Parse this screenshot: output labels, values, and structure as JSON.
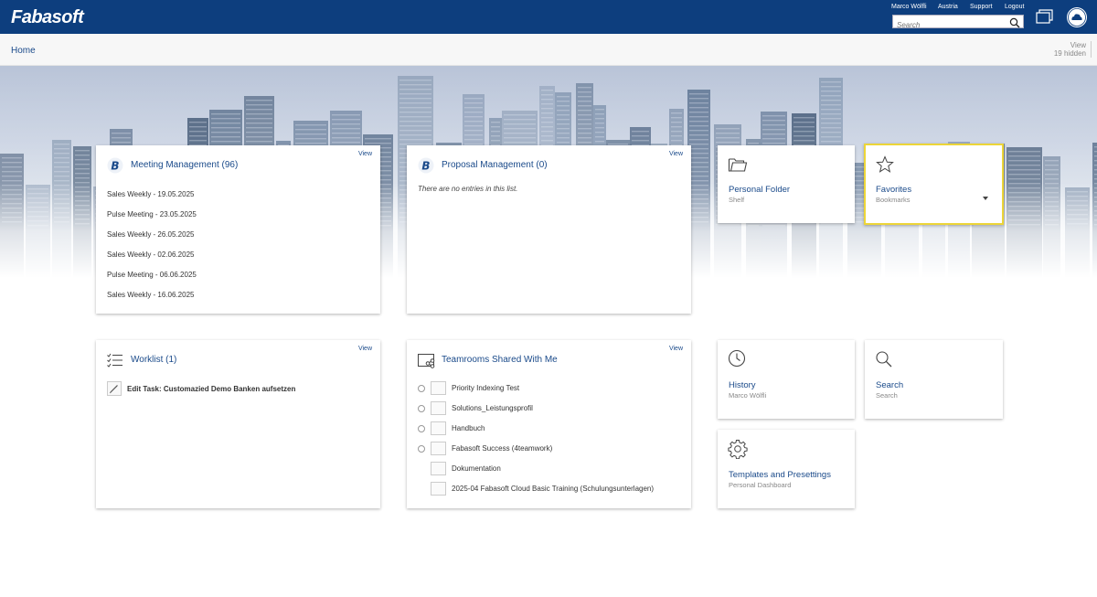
{
  "header": {
    "logo": "Fabasoft",
    "user": "Marco Wölfli",
    "region": "Austria",
    "support": "Support",
    "logout": "Logout",
    "search_placeholder": "Search",
    "accent_color": "#0d3e7e"
  },
  "breadcrumb": {
    "home": "Home",
    "view_label": "View",
    "hidden_count": "19 hidden"
  },
  "widgets": {
    "meeting": {
      "title": "Meeting Management (96)",
      "view": "View",
      "items": [
        "Sales Weekly - 19.05.2025",
        "Pulse Meeting - 23.05.2025",
        "Sales Weekly - 26.05.2025",
        "Sales Weekly - 02.06.2025",
        "Pulse Meeting - 06.06.2025",
        "Sales Weekly - 16.06.2025"
      ]
    },
    "proposal": {
      "title": "Proposal Management (0)",
      "view": "View",
      "empty": "There are no entries in this list."
    },
    "personal_folder": {
      "title": "Personal Folder",
      "subtitle": "Shelf"
    },
    "favorites": {
      "title": "Favorites",
      "subtitle": "Bookmarks"
    },
    "worklist": {
      "title": "Worklist (1)",
      "view": "View",
      "task": "Edit Task: Customazied Demo Banken aufsetzen"
    },
    "teamrooms": {
      "title": "Teamrooms Shared With Me",
      "view": "View",
      "items": [
        "Priority Indexing Test",
        "Solutions_Leistungsprofil",
        "Handbuch",
        "Fabasoft Success (4teamwork)",
        "Dokumentation",
        "2025-04 Fabasoft Cloud Basic Training (Schulungsunterlagen)"
      ]
    },
    "history": {
      "title": "History",
      "subtitle": "Marco Wölfli"
    },
    "search": {
      "title": "Search",
      "subtitle": "Search"
    },
    "templates": {
      "title": "Templates and Presettings",
      "subtitle": "Personal Dashboard"
    }
  }
}
